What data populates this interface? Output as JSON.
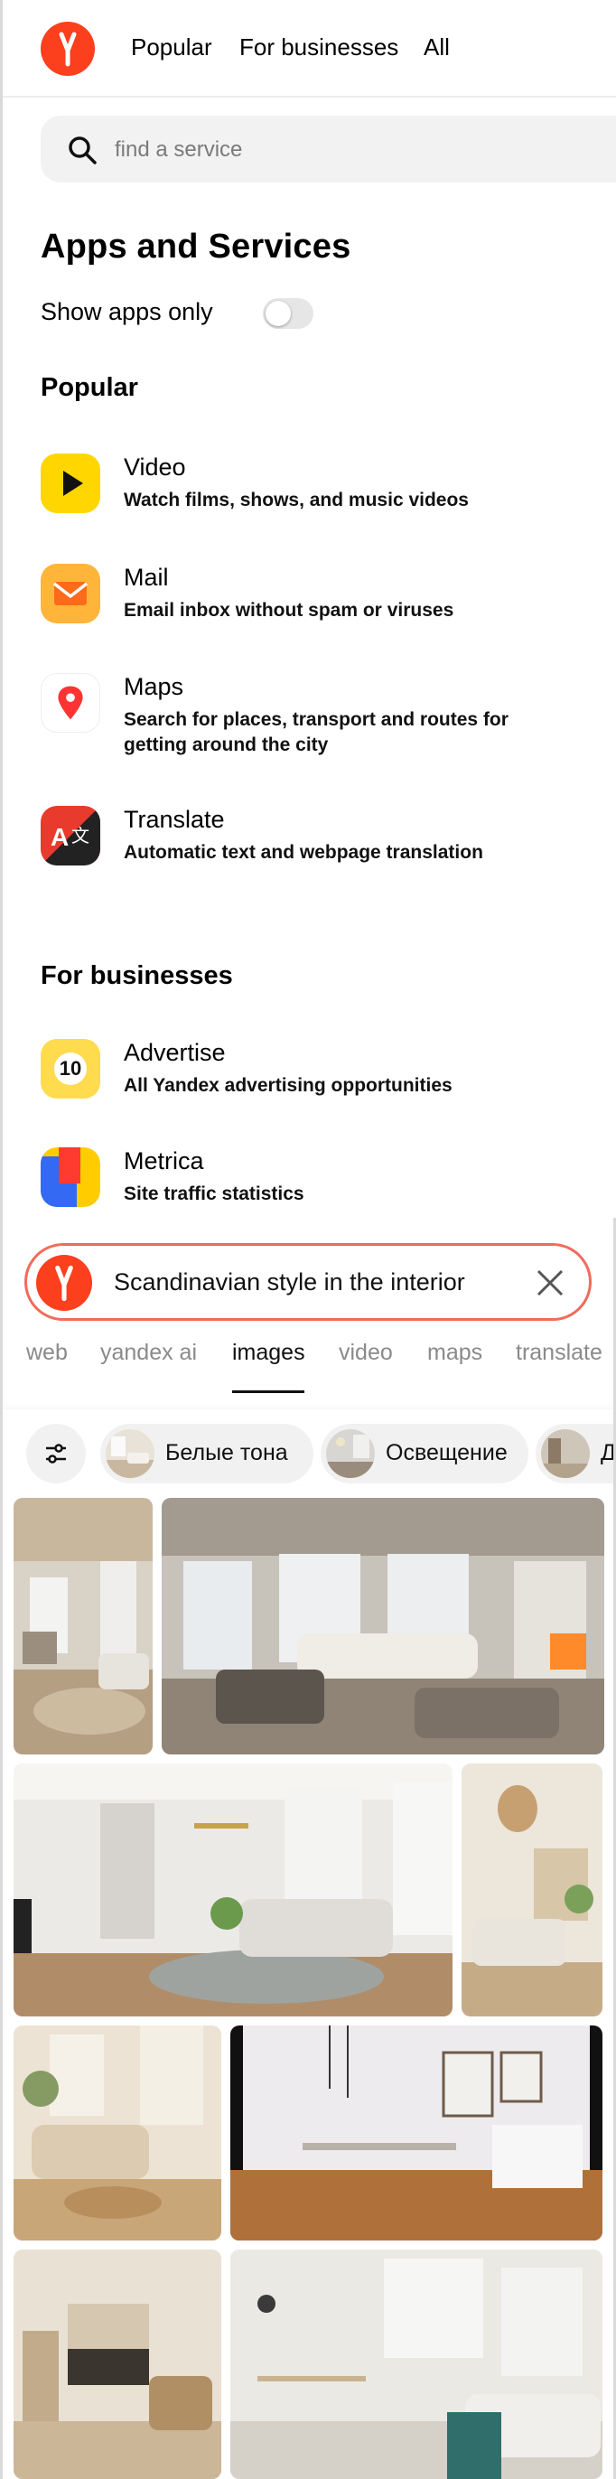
{
  "nav": {
    "links": [
      "Popular",
      "For businesses",
      "All"
    ]
  },
  "search": {
    "placeholder": "find a service"
  },
  "heading": "Apps and Services",
  "toggle": {
    "label": "Show apps only",
    "on": false
  },
  "sections": {
    "popular": "Popular",
    "business": "For businesses"
  },
  "popular_apps": [
    {
      "title": "Video",
      "desc": "Watch films, shows, and music videos"
    },
    {
      "title": "Mail",
      "desc": "Email inbox without spam or viruses"
    },
    {
      "title": "Maps",
      "desc": "Search for places, transport and routes for getting around the city"
    },
    {
      "title": "Translate",
      "desc": "Automatic text and webpage translation"
    }
  ],
  "business_apps": [
    {
      "title": "Advertise",
      "desc": "All Yandex advertising opportunities",
      "badge": "10"
    },
    {
      "title": "Metrica",
      "desc": "Site traffic statistics"
    }
  ],
  "image_search": {
    "query": "Scandinavian style in the interior",
    "tabs": [
      "web",
      "yandex ai",
      "images",
      "video",
      "maps",
      "translate"
    ],
    "active_tab": "images",
    "chips": [
      "Белые тона",
      "Освещение",
      "Д"
    ]
  },
  "colors": {
    "brand": "#fc3f1d",
    "search_border": "#f26b5b",
    "video_icon": "#ffd600",
    "mail_icon": "#ffb43a"
  }
}
